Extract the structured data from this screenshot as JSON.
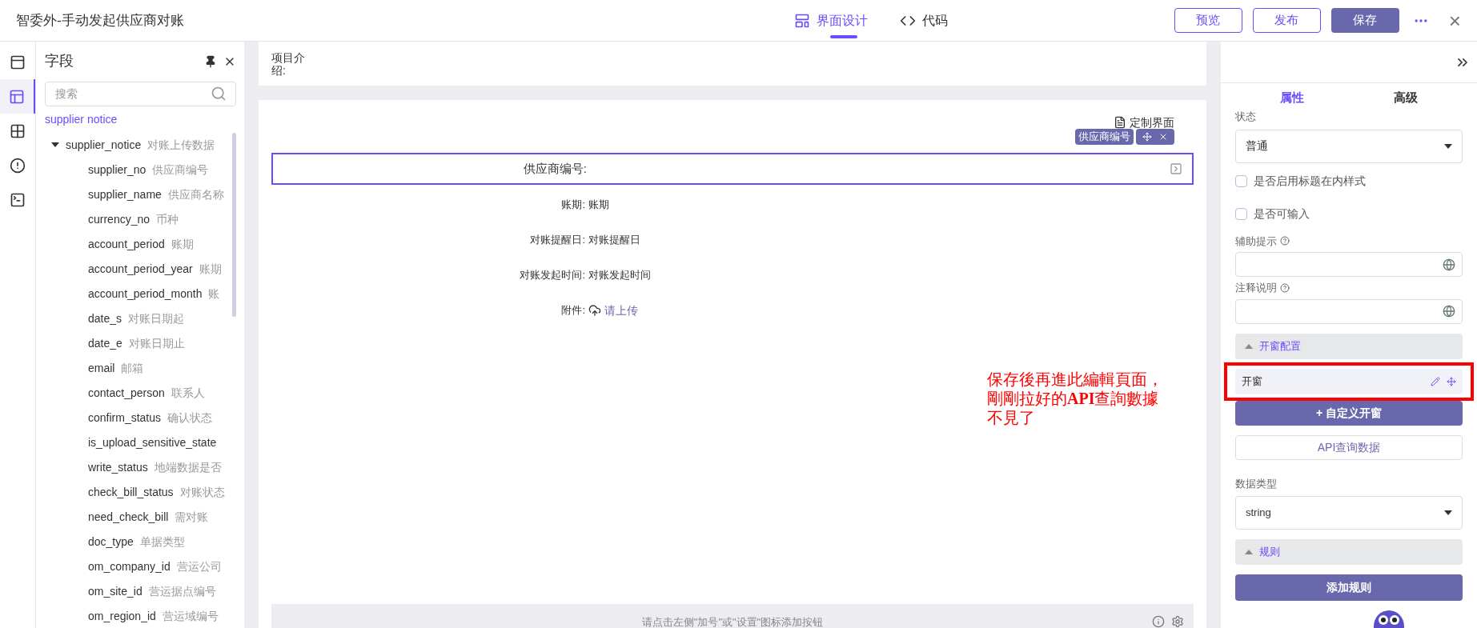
{
  "window": {
    "title": "智委外-手动发起供应商对账",
    "close": "×"
  },
  "mode_tabs": [
    {
      "label": "界面设计",
      "kind": "design",
      "selected": true
    },
    {
      "label": "代码",
      "kind": "code",
      "selected": false
    }
  ],
  "actions": [
    {
      "label": "预览",
      "kind": "outline"
    },
    {
      "label": "发布",
      "kind": "outline"
    },
    {
      "label": "保存",
      "kind": "primary"
    }
  ],
  "rail": [
    {
      "kind": "form",
      "selected": false
    },
    {
      "kind": "fields",
      "selected": true
    },
    {
      "kind": "grid",
      "selected": false
    },
    {
      "kind": "alert",
      "selected": false
    },
    {
      "kind": "terminal",
      "selected": false
    }
  ],
  "fields_panel": {
    "title": "字段",
    "search": {
      "placeholder": "搜索"
    },
    "source": "supplier notice",
    "tree": [
      {
        "name": "supplier_notice",
        "label": "对账上传数据",
        "expanded": true,
        "children": [
          {
            "name": "supplier_no",
            "label": "供应商编号"
          },
          {
            "name": "supplier_name",
            "label": "供应商名称"
          },
          {
            "name": "currency_no",
            "label": "币种"
          },
          {
            "name": "account_period",
            "label": "账期"
          },
          {
            "name": "account_period_year",
            "label": "账期"
          },
          {
            "name": "account_period_month",
            "label": "账"
          },
          {
            "name": "date_s",
            "label": "对账日期起"
          },
          {
            "name": "date_e",
            "label": "对账日期止"
          },
          {
            "name": "email",
            "label": "邮箱"
          },
          {
            "name": "contact_person",
            "label": "联系人"
          },
          {
            "name": "confirm_status",
            "label": "确认状态"
          },
          {
            "name": "is_upload_sensitive_state"
          },
          {
            "name": "write_status",
            "label": "地端数据是否"
          },
          {
            "name": "check_bill_status",
            "label": "对账状态"
          },
          {
            "name": "need_check_bill",
            "label": "需对账"
          },
          {
            "name": "doc_type",
            "label": "单据类型"
          },
          {
            "name": "om_company_id",
            "label": "营运公司"
          },
          {
            "name": "om_site_id",
            "label": "营运据点编号"
          },
          {
            "name": "om_region_id",
            "label": "营运域编号"
          }
        ]
      }
    ]
  },
  "canvas": {
    "intro_label": "项目介绍:",
    "customize": "定制界面",
    "selected_tag": "供应商编号",
    "form": [
      {
        "label": "供应商编号:",
        "kind": "selected"
      },
      {
        "label": "账期:",
        "value": "账期",
        "kind": "text"
      },
      {
        "label": "对账提醒日:",
        "value": "对账提醒日",
        "kind": "text"
      },
      {
        "label": "对账发起时间:",
        "value": "对账发起时间",
        "kind": "text"
      },
      {
        "label": "附件:",
        "value": "请上传",
        "kind": "upload"
      }
    ],
    "annotation": "保存後再進此編輯頁面，剛剛拉好的**API**查詢數據不見了",
    "footer_hint": "请点击左侧\"加号\"或\"设置\"图标添加按钮"
  },
  "props_panel": {
    "tabs": [
      {
        "label": "属性",
        "selected": true
      },
      {
        "label": "高级",
        "selected": false
      }
    ],
    "status_label": "状态",
    "status_value": "普通",
    "checkboxes": [
      {
        "label": "是否启用标题在内样式",
        "checked": false
      },
      {
        "label": "是否可输入",
        "checked": false
      }
    ],
    "hint_label": "辅助提示",
    "note_label": "注释说明",
    "window_section": {
      "title": "开窗配置",
      "expanded": true,
      "items": [
        "开窗"
      ]
    },
    "custom_window_button": "+ 自定义开窗",
    "api_button": "API查询数据",
    "data_type_label": "数据类型",
    "data_type_value": "string",
    "rules_section": {
      "title": "规则",
      "expanded": true
    },
    "add_rule_button": "添加规则"
  }
}
